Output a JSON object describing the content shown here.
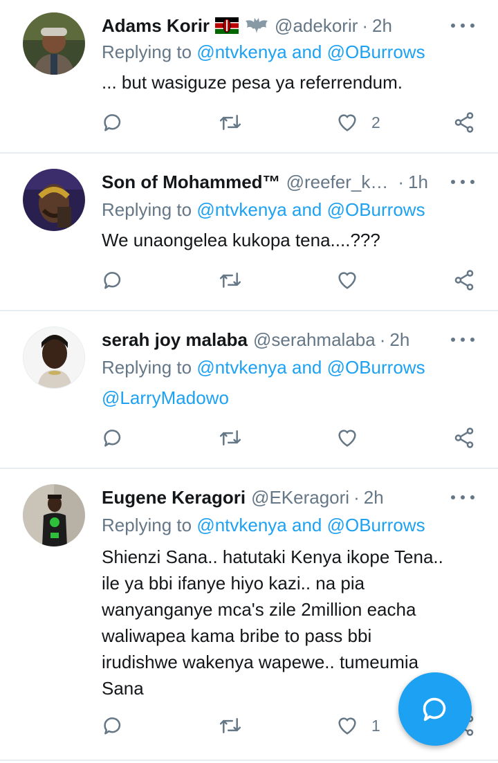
{
  "tweets": [
    {
      "name": "Adams Korir",
      "badges": [
        "kenya-flag",
        "bat-emoji"
      ],
      "handle": "@adekorir",
      "time": "2h",
      "replying_prefix": "Replying to ",
      "replying_links": "@ntvkenya and @OBurrows",
      "body": "... but wasiguze pesa ya referrendum.",
      "likes": "2"
    },
    {
      "name": "Son of Mohammed™",
      "badges": [],
      "handle": "@reefer_k…",
      "time": "1h",
      "replying_prefix": "Replying to ",
      "replying_links": "@ntvkenya and @OBurrows",
      "body": "We unaongelea kukopa tena....???",
      "likes": ""
    },
    {
      "name": "serah joy malaba",
      "badges": [],
      "handle": "@serahmalaba",
      "time": "2h",
      "replying_prefix": "Replying to ",
      "replying_links": "@ntvkenya and @OBurrows",
      "body": "@LarryMadowo",
      "likes": ""
    },
    {
      "name": "Eugene Keragori",
      "badges": [],
      "handle": "@EKeragori",
      "time": "2h",
      "replying_prefix": "Replying to ",
      "replying_links": "@ntvkenya and @OBurrows",
      "body": "Shienzi Sana.. hatutaki Kenya ikope Tena..\nile ya bbi ifanye hiyo kazi.. na pia\nwanyanganye mca's zile 2million eacha\nwaliwapea kama bribe to pass bbi\nirudishwe wakenya wapewe.. tumeumia\nSana",
      "likes": "1"
    }
  ],
  "separator": "·",
  "fab": {
    "icon": "compose-reply-icon"
  },
  "colors": {
    "accent": "#1da1f2",
    "muted": "#657786",
    "divider": "#e6ecf0"
  }
}
